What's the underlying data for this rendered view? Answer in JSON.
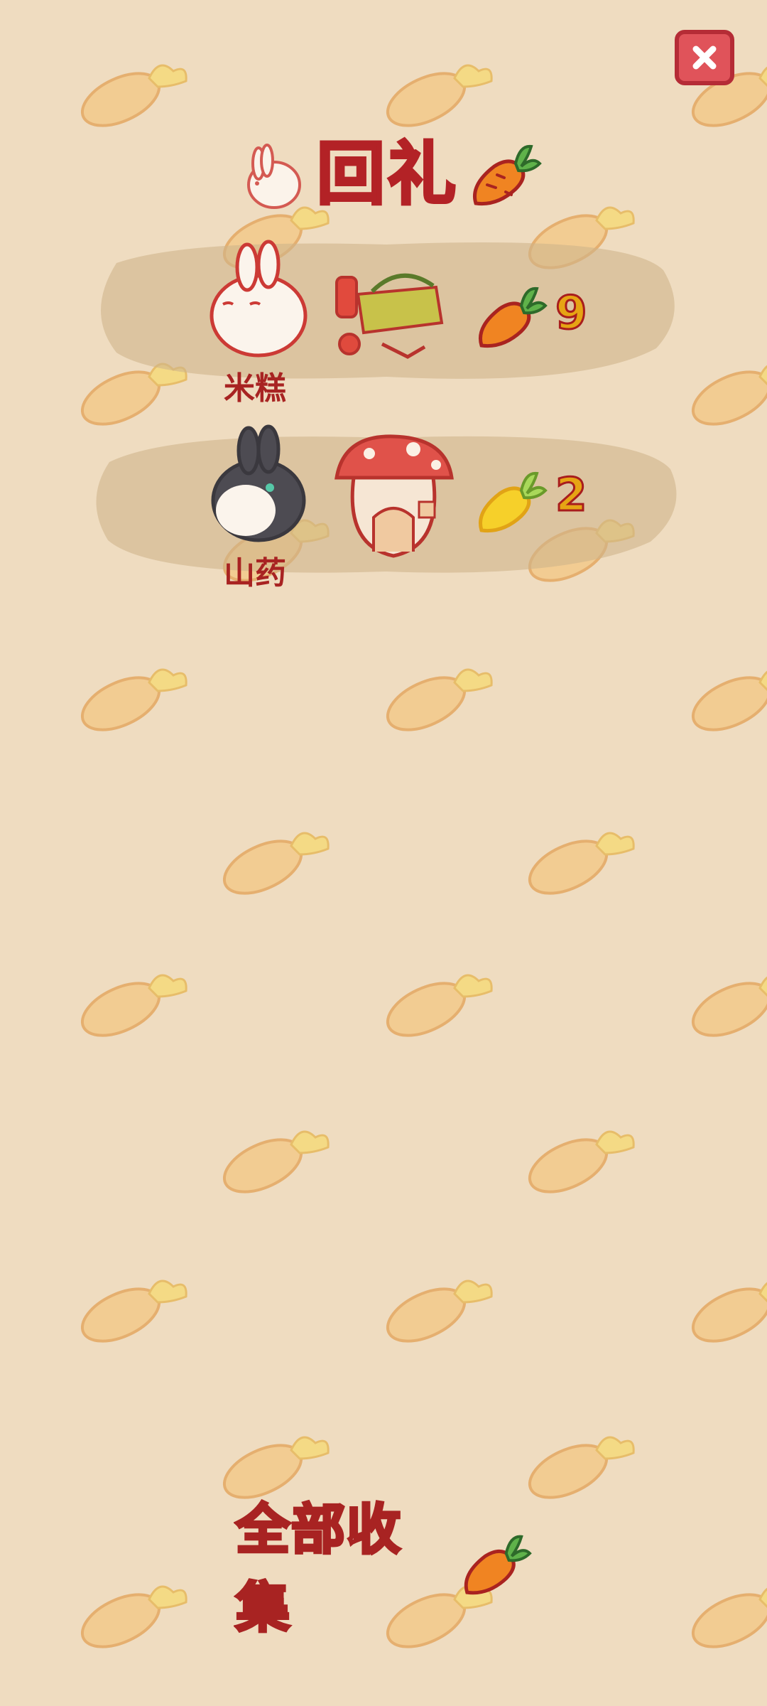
{
  "title": "回礼",
  "close_icon": "close-icon",
  "gifts": [
    {
      "bunny_name": "米糕",
      "bunny_colors": {
        "body": "#fbf4ec",
        "outline": "#cc3a35"
      },
      "item_icon": "picnic-basket-icon",
      "reward_type": "carrot",
      "reward_count": "9"
    },
    {
      "bunny_name": "山药",
      "bunny_colors": {
        "body": "#4d4b52",
        "outline": "#3a383e"
      },
      "item_icon": "mushroom-house-icon",
      "reward_type": "golden-carrot",
      "reward_count": "2"
    }
  ],
  "collect_all_label": "全部收集",
  "colors": {
    "background": "#efdcc0",
    "pattern_carrot": "#f3c27d",
    "accent_red": "#b32226",
    "carrot_orange": "#f08422",
    "gold_carrot": "#f6d02a"
  }
}
